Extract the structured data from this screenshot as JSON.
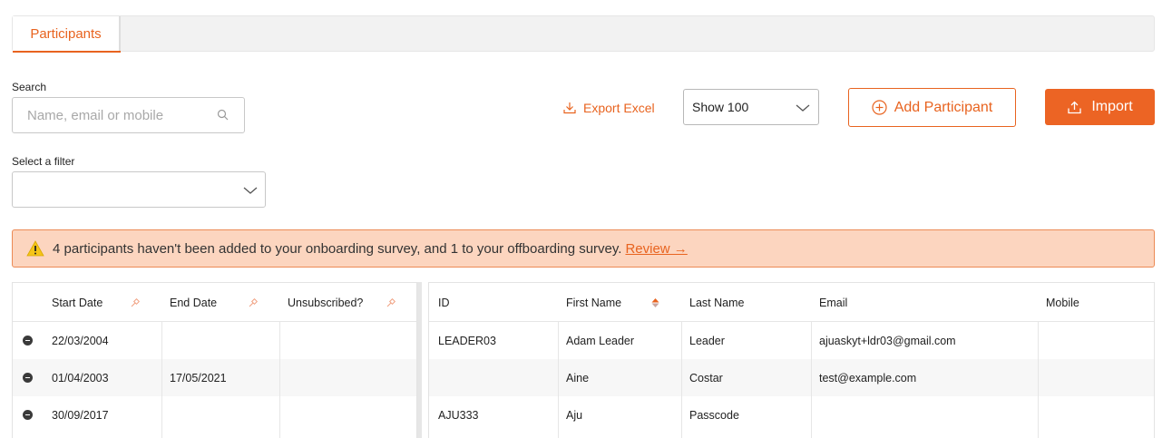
{
  "tabs": [
    {
      "label": "Participants",
      "active": true
    }
  ],
  "search": {
    "label": "Search",
    "placeholder": "Name, email or mobile",
    "value": ""
  },
  "filter": {
    "label": "Select a filter",
    "value": ""
  },
  "toolbar": {
    "export_label": "Export Excel",
    "show_value": "Show 100",
    "add_label": "Add Participant",
    "import_label": "Import"
  },
  "alert": {
    "message": "4 participants haven't been added to your onboarding survey, and 1 to your offboarding survey.",
    "link": "Review →"
  },
  "table": {
    "left_headers": [
      "Start Date",
      "End Date",
      "Unsubscribed?"
    ],
    "right_headers": [
      "ID",
      "First Name",
      "Last Name",
      "Email",
      "Mobile"
    ],
    "rows": [
      {
        "start": "22/03/2004",
        "end": "",
        "unsub": "",
        "id": "LEADER03",
        "first": "Adam Leader",
        "last": "Leader",
        "email": "ajuaskyt+ldr03@gmail.com",
        "mobile": ""
      },
      {
        "start": "01/04/2003",
        "end": "17/05/2021",
        "unsub": "",
        "id": "",
        "first": "Aine",
        "last": "Costar",
        "email": "test@example.com",
        "mobile": ""
      },
      {
        "start": "30/09/2017",
        "end": "",
        "unsub": "",
        "id": "AJU333",
        "first": "Aju",
        "last": "Passcode",
        "email": "",
        "mobile": ""
      }
    ]
  },
  "colors": {
    "accent": "#e8631f",
    "alert_bg": "#fcd5bf",
    "alert_border": "#ec8a55"
  }
}
